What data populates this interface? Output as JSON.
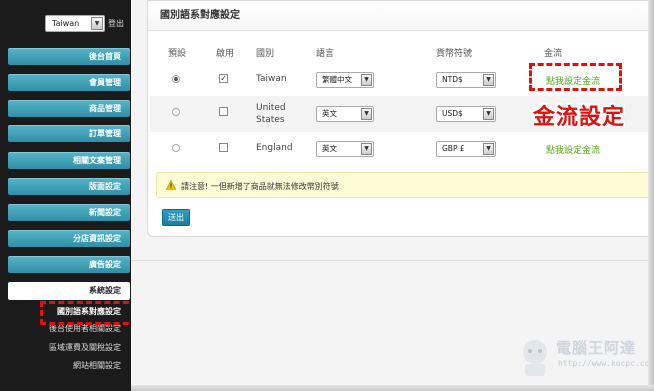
{
  "sidebar": {
    "country": "Taiwan",
    "logout": "登出",
    "items": [
      {
        "label": "後台首頁"
      },
      {
        "label": "會員管理"
      },
      {
        "label": "商品管理"
      },
      {
        "label": "訂單管理"
      },
      {
        "label": "相關文案管理"
      },
      {
        "label": "版面設定"
      },
      {
        "label": "新聞設定"
      },
      {
        "label": "分店資訊設定"
      },
      {
        "label": "廣告設定"
      }
    ],
    "active": "系統設定",
    "subitems": [
      {
        "label": "國別語系對應設定"
      },
      {
        "label": "後台使用者相關設定"
      },
      {
        "label": "區域運費及關稅設定"
      },
      {
        "label": "網站相關設定"
      }
    ]
  },
  "panel": {
    "title": "國別語系對應設定",
    "headers": [
      "預設",
      "啟用",
      "國別",
      "語言",
      "貨幣符號",
      "金流"
    ],
    "rows": [
      {
        "default": true,
        "enabled": true,
        "country": "Taiwan",
        "language": "繁體中文",
        "currency": "NTD$",
        "payment_link": "點我設定金流"
      },
      {
        "default": false,
        "enabled": false,
        "country": "United States",
        "language": "英文",
        "currency": "USD$",
        "payment_link": ""
      },
      {
        "default": false,
        "enabled": false,
        "country": "England",
        "language": "英文",
        "currency": "GBP £",
        "payment_link": "點我設定金流"
      }
    ],
    "notice": "請注意! 一但新增了商品就無法修改幣別符號",
    "submit": "送出"
  },
  "callout": "金流設定",
  "watermark": {
    "title": "電腦王阿達",
    "url": "http://www.kocpc.com.tw"
  },
  "colors": {
    "accent": "#2f8fa6",
    "callout": "#e01010",
    "link": "#54a81a"
  }
}
